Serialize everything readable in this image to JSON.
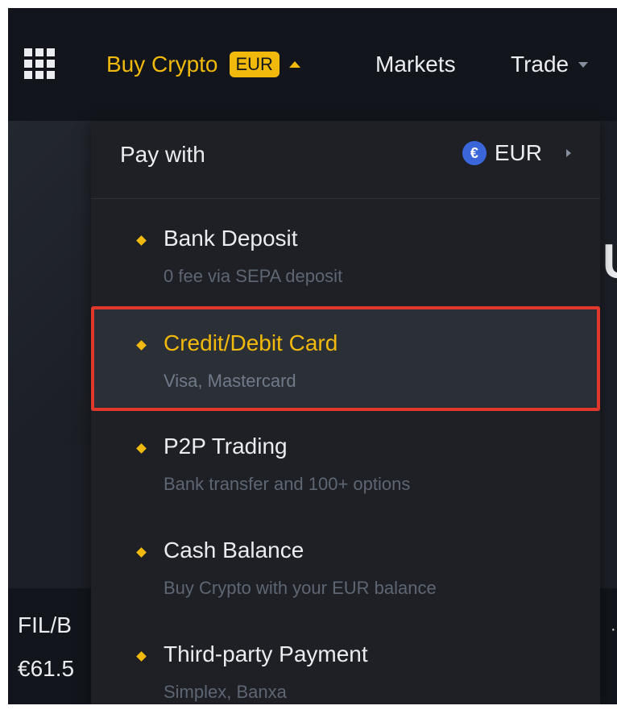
{
  "nav": {
    "buy_crypto_label": "Buy Crypto",
    "currency_badge": "EUR",
    "markets_label": "Markets",
    "trade_label": "Trade"
  },
  "dropdown": {
    "pay_with_label": "Pay with",
    "currency_symbol": "€",
    "currency_label": "EUR",
    "items": [
      {
        "title": "Bank Deposit",
        "subtitle": "0 fee via SEPA deposit"
      },
      {
        "title": "Credit/Debit Card",
        "subtitle": "Visa, Mastercard"
      },
      {
        "title": "P2P Trading",
        "subtitle": "Bank transfer and 100+ options"
      },
      {
        "title": "Cash Balance",
        "subtitle": "Buy Crypto with your EUR balance"
      },
      {
        "title": "Third-party Payment",
        "subtitle": "Simplex, Banxa"
      }
    ]
  },
  "background": {
    "hero_letter": "U",
    "ticker_pair": "FIL/B",
    "ticker_price": "€61.5"
  },
  "colors": {
    "accent": "#f0b90b",
    "highlight": "#e0392b",
    "nav_bg": "#12161c",
    "dropdown_bg": "#1e2026"
  },
  "icons": {
    "apps": "grid-icon",
    "dropdown_open": "caret-up-icon",
    "trade_menu": "caret-down-icon",
    "currency": "euro-coin-icon",
    "currency_more": "caret-right-icon",
    "bullet": "diamond-icon"
  }
}
